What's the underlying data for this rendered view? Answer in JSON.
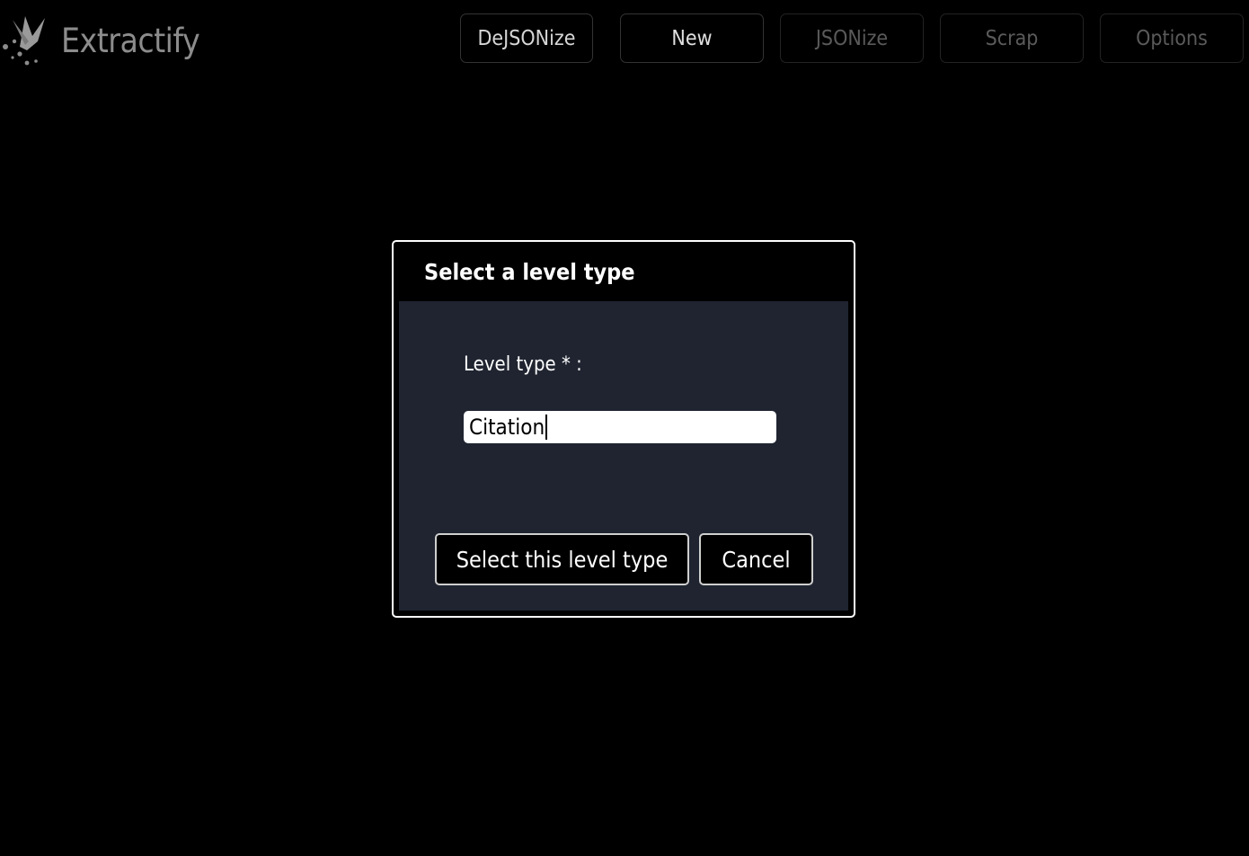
{
  "app": {
    "name": "Extractify",
    "logo_icon": "comet-extractor-icon"
  },
  "toolbar": {
    "buttons": [
      {
        "label": "DeJSONize",
        "enabled": true
      },
      {
        "label": "New",
        "enabled": true
      },
      {
        "label": "JSONize",
        "enabled": false
      },
      {
        "label": "Scrap",
        "enabled": false
      },
      {
        "label": "Options",
        "enabled": false
      }
    ]
  },
  "dialog": {
    "title": "Select a level type",
    "field_label": "Level type * :",
    "input_value": "Citation",
    "confirm_label": "Select this level type",
    "cancel_label": "Cancel"
  },
  "colors": {
    "background": "#000000",
    "dialog_body": "#1f2430",
    "logo_text": "#8c8c8c",
    "disabled_text": "#5a5a5a"
  }
}
